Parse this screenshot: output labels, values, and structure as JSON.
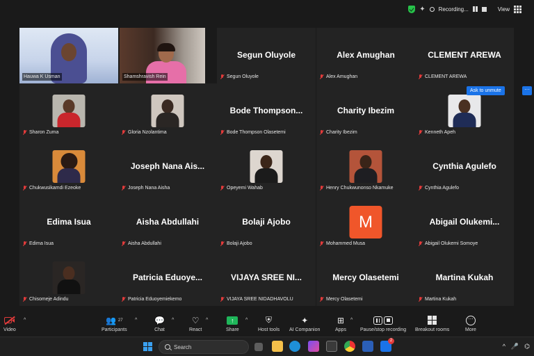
{
  "topbar": {
    "recording_label": "Recording...",
    "view_label": "View"
  },
  "gallery": {
    "tiles": [
      {
        "name": "Hauwa K Usman",
        "type": "video",
        "active": true
      },
      {
        "name": "Shamshravish Rein",
        "type": "video"
      },
      {
        "name": "Segun Oluyole",
        "display": "Segun Oluyole",
        "type": "text"
      },
      {
        "name": "Alex Amughan",
        "display": "Alex Amughan",
        "type": "text"
      },
      {
        "name": "CLEMENT AREWA",
        "display": "CLEMENT AREWA",
        "type": "text"
      },
      {
        "name": "Sharon Zuma",
        "type": "photo"
      },
      {
        "name": "Gloria Nzolantima",
        "type": "photo"
      },
      {
        "name": "Bode Thompson Olasetemi",
        "display": "Bode  Thompson...",
        "type": "text"
      },
      {
        "name": "Charity Ibezim",
        "display": "Charity Ibezim",
        "type": "text"
      },
      {
        "name": "Kenneth Apeh",
        "type": "photo"
      },
      {
        "name": "Chukwusikamdi Ezeoke",
        "type": "photo"
      },
      {
        "name": "Joseph Nana Aisha",
        "display": "Joseph  Nana  Ais...",
        "type": "text"
      },
      {
        "name": "Opeyemi Wahab",
        "type": "photo"
      },
      {
        "name": "Henry Chukwunonso Nkamuke",
        "type": "photo"
      },
      {
        "name": "Cynthia Agulefo",
        "display": "Cynthia Agulefo",
        "type": "text"
      },
      {
        "name": "Edima Isua",
        "display": "Edima Isua",
        "type": "text"
      },
      {
        "name": "Aisha Abdullahi",
        "display": "Aisha Abdullahi",
        "type": "text"
      },
      {
        "name": "Bolaji Ajobo",
        "display": "Bolaji Ajobo",
        "type": "text"
      },
      {
        "name": "Mohammed Musa",
        "avatar_letter": "M",
        "type": "avatar"
      },
      {
        "name": "Abigail Olukemi Somoye",
        "display": "Abigail  Olukemi...",
        "type": "text"
      },
      {
        "name": "Chisomeje Adindu",
        "type": "photo"
      },
      {
        "name": "Patricia Eduoyemiekemo",
        "display": "Patricia  Eduoye...",
        "type": "text"
      },
      {
        "name": "VIJAYA SREE NIDADHAVOLU",
        "display": "VIJAYA  SREE  NI...",
        "type": "text"
      },
      {
        "name": "Mercy Olasetemi",
        "display": "Mercy Olasetemi",
        "type": "text"
      },
      {
        "name": "Martina Kukah",
        "display": "Martina Kukah",
        "type": "text"
      }
    ],
    "ask_to_unmute": "Ask to unmute",
    "more_dots": "···"
  },
  "toolbar": {
    "video": "Video",
    "participants": "Participants",
    "participants_count": "27",
    "chat": "Chat",
    "react": "React",
    "share": "Share",
    "host_tools": "Host tools",
    "ai_companion": "AI Companion",
    "apps": "Apps",
    "pause_stop_recording": "Pause/stop recording",
    "breakout_rooms": "Breakout rooms",
    "more": "More"
  },
  "taskbar": {
    "search_label": "Search",
    "mail_badge": "2"
  },
  "colors": {
    "active_speaker_border": "#3fd16b",
    "muted_mic": "#e23b3b",
    "unmute_button": "#1a73e8",
    "share_green": "#1fb65a",
    "avatar_orange": "#f0562a"
  }
}
